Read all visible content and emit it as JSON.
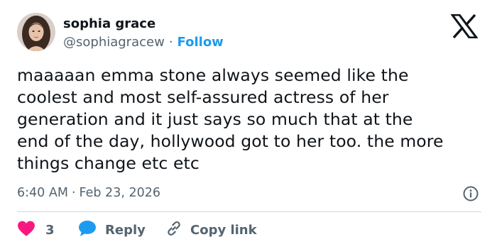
{
  "tweet": {
    "author": {
      "name": "sophia grace",
      "handle": "@sophiagracew",
      "separator": "·",
      "follow_label": "Follow"
    },
    "text_lines": [
      "maaaaan emma stone always seemed like the",
      "coolest and most self-assured actress of her",
      "generation and it just says so much that at the",
      "end of the day, hollywood got to her too. the more",
      "things change etc etc"
    ],
    "time": "6:40 AM",
    "meta_separator": "·",
    "date": "Feb 23, 2026",
    "actions": {
      "like_count": "3",
      "reply_label": "Reply",
      "copy_label": "Copy link"
    }
  },
  "icons": {
    "brand": "x-logo-icon",
    "info": "info-icon",
    "like": "heart-icon",
    "reply": "speech-bubble-icon",
    "copy": "link-icon"
  },
  "colors": {
    "link": "#1d9bf0",
    "secondary_text": "#536471",
    "primary_text": "#0f1419",
    "heart": "#f91880",
    "divider": "#cfd9de"
  }
}
